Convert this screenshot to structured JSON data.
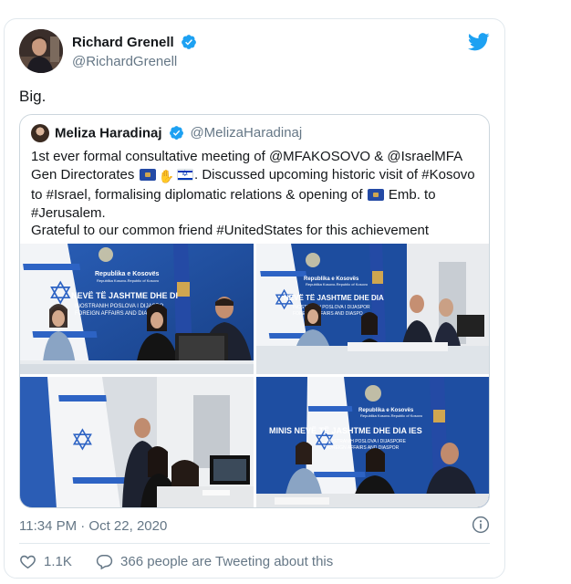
{
  "author": {
    "name": "Richard Grenell",
    "handle": "@RichardGrenell",
    "verified_icon": "verified-badge-icon"
  },
  "tweet_text": "Big.",
  "quoted_tweet": {
    "name": "Meliza Haradinaj",
    "handle": "@MelizaHaradinaj",
    "lines": {
      "l1": "1st ever formal consultative meeting of @MFAKOSOVO & @IsraelMFA",
      "l2_a": "Gen Directorates",
      "l2_b": ". Discussed upcoming historic visit of #Kosovo",
      "l3_a": "to #Israel, formalising diplomatic relations & opening of",
      "l3_b": "Emb. to",
      "l4": "#Jerusalem.",
      "l5": "Grateful to our common friend #UnitedStates for this achievement"
    },
    "emoji": [
      "kosovo-flag",
      "handshake",
      "israel-flag",
      "kosovo-flag"
    ],
    "photos": [
      "meeting-photo-1",
      "meeting-photo-2",
      "meeting-photo-3",
      "meeting-photo-4"
    ],
    "photo_text": {
      "p1_l1": "Republika e Kosovës",
      "p1_l2": "Republika Kosovo-Republic of Kosovo",
      "p1_l3": "NEVË TË JASHTME DHE DI",
      "p1_l4": "INOSTRANIH POSLOVA I DIJASPO",
      "p1_l5": "FOREIGN AFFAIRS AND DIASPO",
      "p2_l1": "Republika e Kosovës",
      "p2_l2": "Republika Kosovo-Republic of Kosovo",
      "p2_l3": "NEVË TË JASHTME DHE DIA",
      "p2_l4": "INOSTRANIH POSLOVA I DIJASPOR",
      "p2_l5": "FOREIGN AFFAIRS AND DIASPO",
      "p4_l1": "Republika e Kosovës",
      "p4_l2": "Republika Kosovo-Republic of Kosovo",
      "p4_l3": "MINIS NEVË TË JASHTME DHE DIA IES",
      "p4_l4": "INOSTRANIH POSLOVA I DIJASPORE",
      "p4_l5": "FOREIGN AFFAIRS AND DIASPOR"
    }
  },
  "timestamp": "11:34 PM · Oct 22, 2020",
  "actions": {
    "likes": "1.1K",
    "replies_text": "366 people are Tweeting about this"
  },
  "colors": {
    "twitter_blue": "#1da1f2",
    "secondary_text": "#657786",
    "border": "#e1e8ed"
  }
}
